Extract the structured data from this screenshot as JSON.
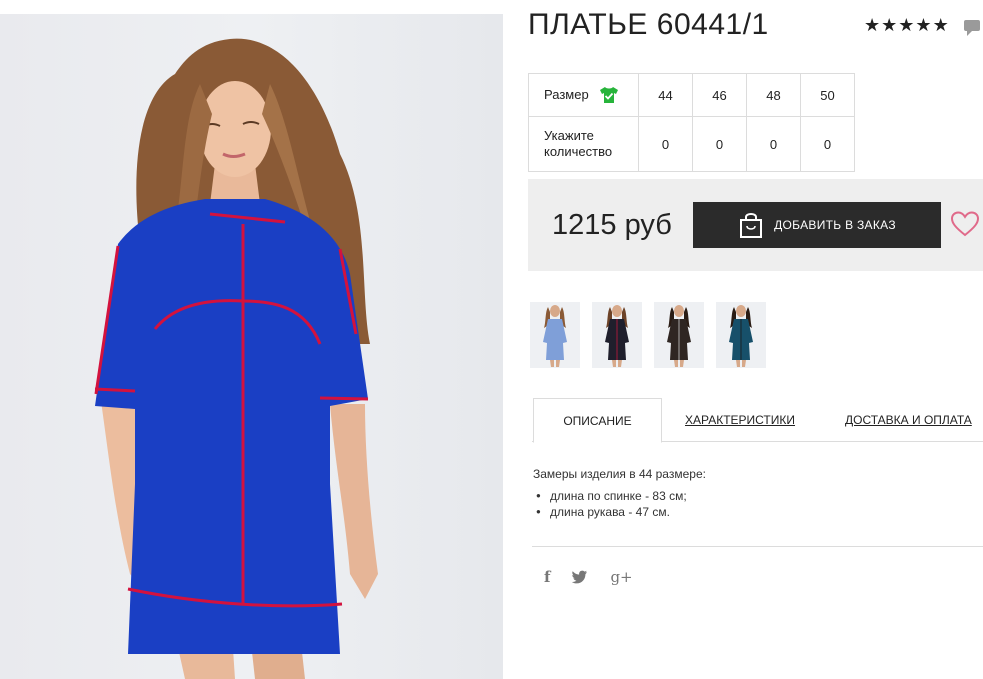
{
  "product": {
    "title": "ПЛАТЬЕ 60441/1",
    "rating_stars": 5,
    "photo_icon": "model-photo"
  },
  "sizes": {
    "size_label": "Размер",
    "qty_label": "Укажите количество",
    "values": [
      "44",
      "46",
      "48",
      "50"
    ],
    "quantities": [
      "0",
      "0",
      "0",
      "0"
    ],
    "size_chart_icon": "tshirt-check-icon",
    "icon_color": "#27b43b"
  },
  "purchase": {
    "price": "1215 руб",
    "add_button_label": "ДОБАВИТЬ В ЗАКАЗ",
    "heart_color": "#e06a8a"
  },
  "thumbnails": [
    {
      "name": "light-blue",
      "color": "#7f9fd8"
    },
    {
      "name": "black",
      "color": "#1f1f2c"
    },
    {
      "name": "dark-brown",
      "color": "#2f2622"
    },
    {
      "name": "teal",
      "color": "#17506a"
    }
  ],
  "tabs": {
    "description": "ОПИСАНИЕ",
    "characteristics": "ХАРАКТЕРИСТИКИ",
    "delivery": "ДОСТАВКА И ОПЛАТА"
  },
  "description": {
    "intro": "Замеры изделия в 44 размере:",
    "items": [
      "длина по спинке - 83 см;",
      "длина рукава - 47 см."
    ]
  },
  "social": {
    "facebook": "f",
    "twitter": "🐦",
    "googleplus": "g+"
  },
  "colors": {
    "dress_blue": "#1a3fc4",
    "piping_red": "#d3123e"
  }
}
